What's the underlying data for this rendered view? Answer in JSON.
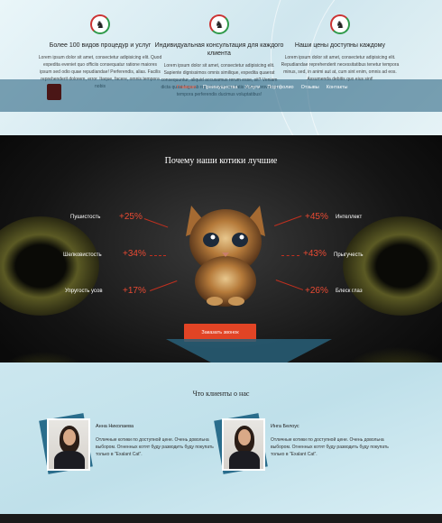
{
  "features": [
    {
      "icon": "cat-icon",
      "title": "Более 100 видов процедур и услуг",
      "text": "Lorem ipsum dolor sit amet, consectetur adipisicing elit. Quod expedita eveniet quo officiis consequatur ratione maiores ipsum sed odio quae repudiandae! Perferendis, alias. Facilis reprehenderit dolorem, error. Itaque, facere, omnis tempora nobis"
    },
    {
      "icon": "cat-icon",
      "title": "Индивидуальная консультация для каждого клиента",
      "text": "Lorem ipsum dolor sit amet, consectetur adipisicing elit. Sapiente dignissimos omnis similique, expedita quaerat consequuntur, aliquid accusamus rerum esse, sit? Veniam dicta quasi fuga ab reprehenderit veritatis facilis, provident tempora perferendis ducimus voluptatibus!"
    },
    {
      "icon": "cat-icon",
      "title": "Наши цены доступны каждому",
      "text": "Lorem ipsum dolor sit amet, consectetur adipisicing elit. Repudiandae reprehenderit necessitatibus tenetur tempora minus, sed, in animi aut at, cum sint enim, omnis ad eos. Assumenda debitis quo eius sint!"
    }
  ],
  "nav": {
    "items": [
      "Главная",
      "Преимущества",
      "Услуги",
      "Портфолио",
      "Отзывы",
      "Контакты"
    ],
    "active_index": 0
  },
  "why": {
    "heading": "Почему наши котики лучшие",
    "traits": [
      {
        "label": "Пушистость",
        "percent": "+25%"
      },
      {
        "label": "Шелковистость",
        "percent": "+34%"
      },
      {
        "label": "Упругость усов",
        "percent": "+17%"
      },
      {
        "label": "Интеллект",
        "percent": "+45%"
      },
      {
        "label": "Прыгучесть",
        "percent": "+43%"
      },
      {
        "label": "Блеск глаз",
        "percent": "+26%"
      }
    ],
    "cta_label": "Заказать звонок"
  },
  "reviews": {
    "heading": "Что клиенты о нас",
    "items": [
      {
        "name": "Анна Николаева",
        "text": "Отличные котики по доступной цене. Очень довольна выбором. Огненных котят буду разводить буду покупать только в \"Exalant Cat\"."
      },
      {
        "name": "Инга Белоус",
        "text": "Отличные котики по доступной цене. Очень довольна выбором. Огненных котят буду разводить буду покупать только в \"Exalant Cat\"."
      }
    ]
  },
  "colors": {
    "accent": "#e24425",
    "nav_active": "#ff5a3c",
    "nav_bar": "#1e5a78"
  }
}
